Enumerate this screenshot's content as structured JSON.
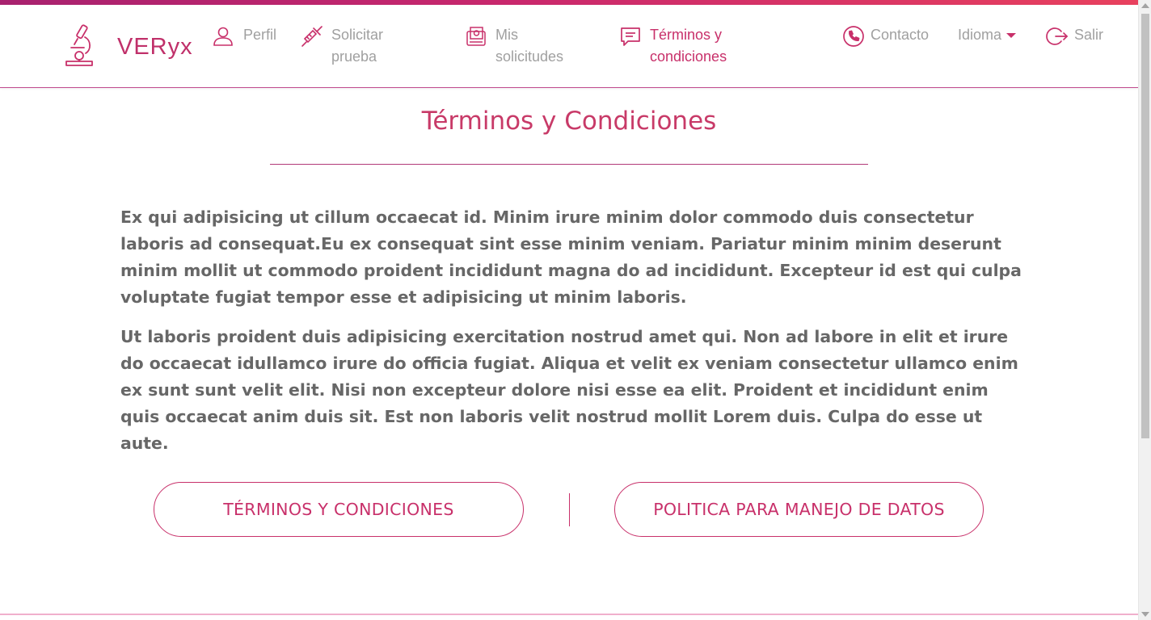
{
  "brand": {
    "name": "VERyx",
    "icon": "microscope-icon"
  },
  "nav": {
    "items": [
      {
        "label": "Perfil",
        "icon": "user-icon"
      },
      {
        "label": "Solicitar prueba",
        "icon": "syringe-icon"
      },
      {
        "label": "Mis solicitudes",
        "icon": "documents-icon"
      },
      {
        "label": "Términos y condiciones",
        "icon": "message-icon",
        "active": true
      }
    ],
    "contact": {
      "label": "Contacto",
      "icon": "phone-icon"
    },
    "language": {
      "label": "Idioma",
      "icon": "caret-down-icon"
    },
    "logout": {
      "label": "Salir",
      "icon": "logout-icon"
    }
  },
  "page": {
    "title": "Términos y Condiciones",
    "paragraphs": [
      "Ex qui adipisicing ut cillum occaecat id. Minim irure minim dolor commodo duis consectetur laboris ad consequat.Eu ex consequat sint esse minim veniam. Pariatur minim minim deserunt minim mollit ut commodo proident incididunt magna do ad incididunt. Excepteur id est qui culpa voluptate fugiat tempor esse et adipisicing ut minim laboris.",
      "Ut laboris proident duis adipisicing exercitation nostrud amet qui. Non ad labore in elit et irure do occaecat idullamco irure do officia fugiat. Aliqua et velit ex veniam consectetur ullamco enim ex sunt sunt velit elit. Nisi non excepteur dolore nisi esse ea elit. Proident et incididunt enim quis occaecat anim duis sit. Est non laboris velit nostrud mollit Lorem duis. Culpa do esse ut aute."
    ],
    "buttons": {
      "terms": "TÉRMINOS Y CONDICIONES",
      "policy": "POLITICA PARA MANEJO DE DATOS"
    }
  },
  "colors": {
    "accent": "#c8306a",
    "gradient_start": "#a8216f",
    "gradient_end": "#e8415e",
    "nav_text": "#a0a0a0",
    "body_text": "#676767"
  }
}
